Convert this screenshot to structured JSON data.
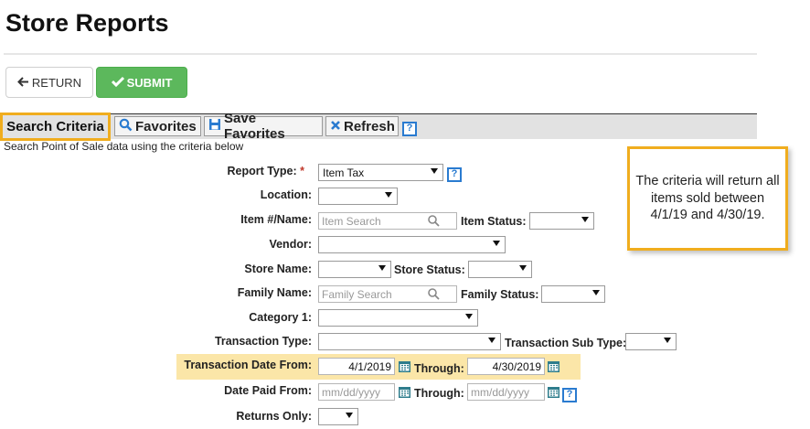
{
  "page": {
    "title": "Store Reports"
  },
  "actions": {
    "return_label": "RETURN",
    "submit_label": "SUBMIT"
  },
  "toolbar": {
    "search_criteria": "Search Criteria",
    "favorites": "Favorites",
    "save_favorites": "Save Favorites",
    "refresh": "Refresh",
    "help": "?"
  },
  "subtitle": "Search Point of Sale data using the criteria below",
  "form": {
    "report_type": {
      "label": "Report Type:",
      "required": "*",
      "value": "Item Tax"
    },
    "location": {
      "label": "Location:",
      "value": ""
    },
    "item_name": {
      "label": "Item #/Name:",
      "placeholder": "Item Search"
    },
    "item_status": {
      "label": "Item Status:",
      "value": ""
    },
    "vendor": {
      "label": "Vendor:",
      "value": ""
    },
    "store_name": {
      "label": "Store Name:",
      "value": ""
    },
    "store_status": {
      "label": "Store Status:",
      "value": ""
    },
    "family_name": {
      "label": "Family Name:",
      "placeholder": "Family Search"
    },
    "family_status": {
      "label": "Family Status:",
      "value": ""
    },
    "category_1": {
      "label": "Category 1:",
      "value": ""
    },
    "transaction_type": {
      "label": "Transaction Type:",
      "value": ""
    },
    "transaction_sub_type": {
      "label": "Transaction Sub Type:",
      "value": ""
    },
    "transaction_date_from": {
      "label": "Transaction Date From:",
      "value": "4/1/2019"
    },
    "transaction_through": {
      "label": "Through:",
      "value": "4/30/2019"
    },
    "date_paid_from": {
      "label": "Date Paid From:",
      "placeholder": "mm/dd/yyyy"
    },
    "date_paid_through": {
      "label": "Through:",
      "placeholder": "mm/dd/yyyy"
    },
    "returns_only": {
      "label": "Returns Only:",
      "value": ""
    }
  },
  "callout": {
    "text": "The criteria will return all items sold between 4/1/19 and 4/30/19."
  },
  "colors": {
    "submit": "#5cb85c",
    "highlight": "#fbe6a8",
    "accent_border": "#f0ad1e",
    "help_blue": "#2a7bd0"
  },
  "icons": [
    "arrow-left-icon",
    "check-icon",
    "search-icon",
    "save-icon",
    "close-icon",
    "help-icon",
    "calendar-icon",
    "magnifier-icon"
  ]
}
